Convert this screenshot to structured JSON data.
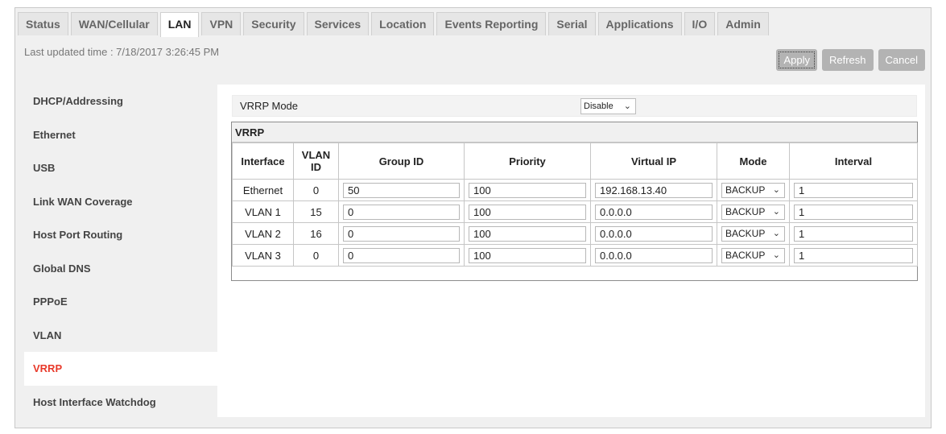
{
  "tabs": [
    "Status",
    "WAN/Cellular",
    "LAN",
    "VPN",
    "Security",
    "Services",
    "Location",
    "Events Reporting",
    "Serial",
    "Applications",
    "I/O",
    "Admin"
  ],
  "active_tab": "LAN",
  "updated": "Last updated time : 7/18/2017 3:26:45 PM",
  "actions": {
    "apply": "Apply",
    "refresh": "Refresh",
    "cancel": "Cancel"
  },
  "sidebar": {
    "items": [
      "DHCP/Addressing",
      "Ethernet",
      "USB",
      "Link WAN Coverage",
      "Host Port Routing",
      "Global DNS",
      "PPPoE",
      "VLAN",
      "VRRP",
      "Host Interface Watchdog"
    ],
    "active": "VRRP"
  },
  "vrrp_mode": {
    "label": "VRRP Mode",
    "value": "Disable"
  },
  "vrrp_table": {
    "title": "VRRP",
    "headers": [
      "Interface",
      "VLAN ID",
      "Group ID",
      "Priority",
      "Virtual IP",
      "Mode",
      "Interval"
    ],
    "rows": [
      {
        "interface": "Ethernet",
        "vlan_id": "0",
        "group_id": "50",
        "priority": "100",
        "virtual_ip": "192.168.13.40",
        "mode": "BACKUP",
        "interval": "1"
      },
      {
        "interface": "VLAN 1",
        "vlan_id": "15",
        "group_id": "0",
        "priority": "100",
        "virtual_ip": "0.0.0.0",
        "mode": "BACKUP",
        "interval": "1"
      },
      {
        "interface": "VLAN 2",
        "vlan_id": "16",
        "group_id": "0",
        "priority": "100",
        "virtual_ip": "0.0.0.0",
        "mode": "BACKUP",
        "interval": "1"
      },
      {
        "interface": "VLAN 3",
        "vlan_id": "0",
        "group_id": "0",
        "priority": "100",
        "virtual_ip": "0.0.0.0",
        "mode": "BACKUP",
        "interval": "1"
      }
    ]
  },
  "colors": {
    "active_sidebar": "#e8392a",
    "button": "#b3b3b3"
  }
}
